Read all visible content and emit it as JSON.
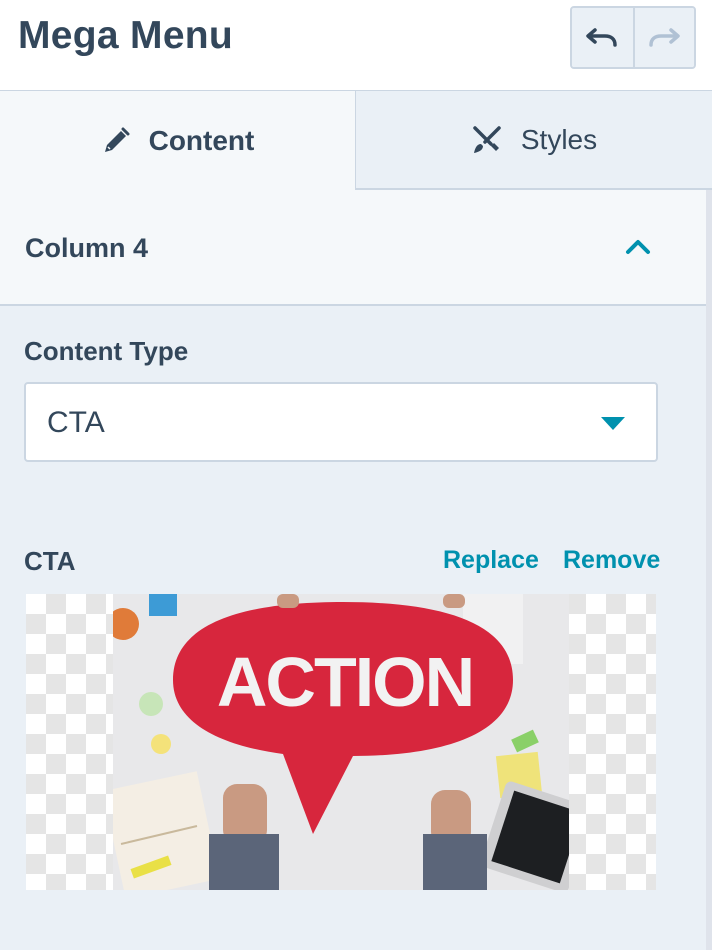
{
  "header": {
    "title": "Mega Menu",
    "undo_icon": "undo-icon",
    "redo_icon": "redo-icon"
  },
  "tabs": [
    {
      "label": "Content",
      "icon": "pencil-icon",
      "active": true
    },
    {
      "label": "Styles",
      "icon": "brush-icon",
      "active": false
    }
  ],
  "accordion": {
    "title": "Column 4",
    "icon": "chevron-up-icon",
    "expanded": true
  },
  "content_type": {
    "label": "Content Type",
    "value": "CTA"
  },
  "cta": {
    "label": "CTA",
    "replace_label": "Replace",
    "remove_label": "Remove",
    "image_text": "ACTION"
  },
  "colors": {
    "text": "#33475b",
    "accent": "#0091ae",
    "border": "#cbd6e2",
    "panel_bg": "#eaf0f6",
    "cta_red": "#d7263d"
  }
}
